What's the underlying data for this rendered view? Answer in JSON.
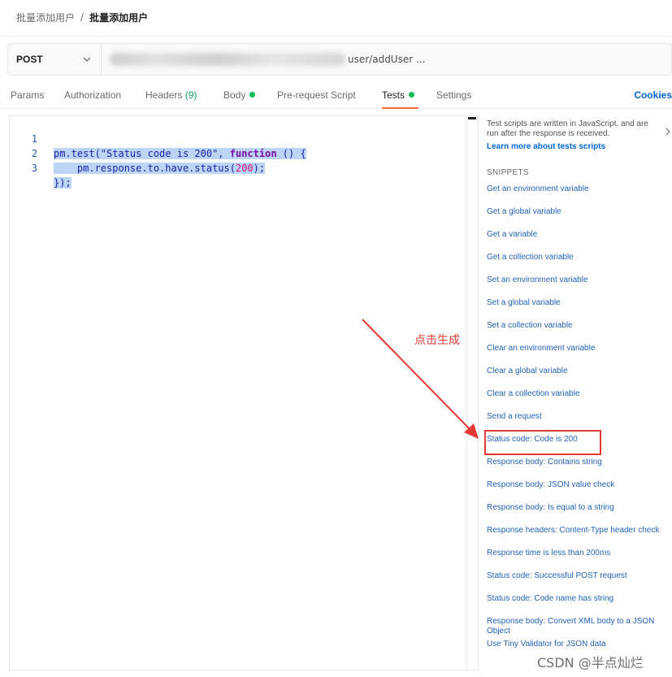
{
  "breadcrumb": {
    "parent": "批量添加用户",
    "separator": "/",
    "current": "批量添加用户"
  },
  "request": {
    "method": "POST",
    "url_visible": "user/addUser ..."
  },
  "tabs": [
    {
      "label": "Params"
    },
    {
      "label": "Authorization"
    },
    {
      "label": "Headers",
      "count": "(9)"
    },
    {
      "label": "Body",
      "dot": true
    },
    {
      "label": "Pre-request Script"
    },
    {
      "label": "Tests",
      "dot": true,
      "active": true
    },
    {
      "label": "Settings"
    }
  ],
  "cookies_label": "Cookies",
  "editor": {
    "line_numbers": [
      "1",
      "2",
      "3"
    ],
    "line1": {
      "fn": "pm.test(",
      "str": "\"Status code is 200\"",
      "comma": ", ",
      "kw": "function",
      "rest": " () {"
    },
    "line2": {
      "indent": "    ",
      "fn": "pm.response.to.have.status(",
      "num": "200",
      "end": ");"
    },
    "line3": {
      "text": "});"
    }
  },
  "sidebar": {
    "intro": "Test scripts are written in JavaScript, and are run after the response is received.",
    "learn_link": "Learn more about tests scripts",
    "snippets_heading": "SNIPPETS",
    "snippets": [
      "Get an environment variable",
      "Get a global variable",
      "Get a variable",
      "Get a collection variable",
      "Set an environment variable",
      "Set a global variable",
      "Set a collection variable",
      "Clear an environment variable",
      "Clear a global variable",
      "Clear a collection variable",
      "Send a request",
      "Status code: Code is 200",
      "Response body: Contains string",
      "Response body: JSON value check",
      "Response body: Is equal to a string",
      "Response headers: Content-Type header check",
      "Response time is less than 200ms",
      "Status code: Successful POST request",
      "Status code: Code name has string",
      "Response body: Convert XML body to a JSON Object",
      "Use Tiny Validator for JSON data"
    ]
  },
  "annotation": {
    "label": "点击生成",
    "color": "#e53935"
  },
  "watermark": "CSDN @半点灿烂",
  "colors": {
    "accent": "#ff6c37",
    "link": "#2264b8",
    "dot": "#0cbb52",
    "annotation": "#e53935"
  }
}
